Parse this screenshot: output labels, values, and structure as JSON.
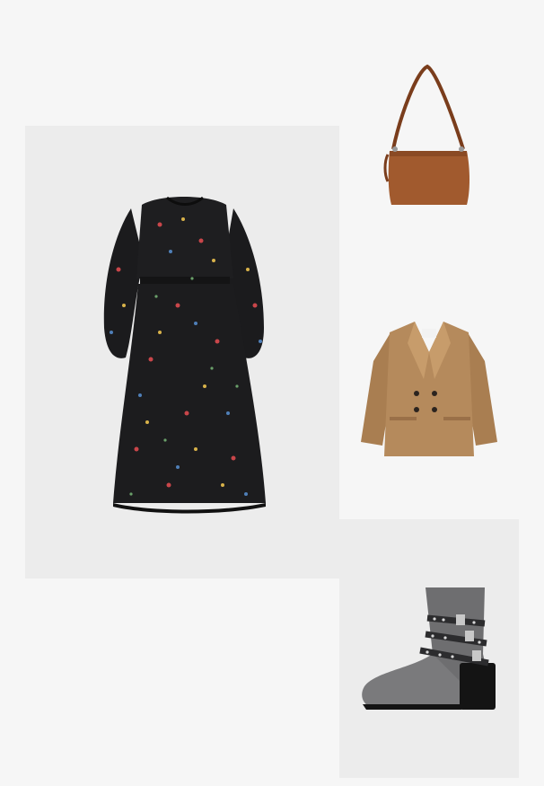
{
  "outfit": {
    "items": [
      {
        "id": "dress",
        "name": "floral-midi-dress",
        "color": "#1b1b1d",
        "panel_color": "#ececec"
      },
      {
        "id": "bag",
        "name": "leather-shoulder-bag",
        "color": "#a15a2e"
      },
      {
        "id": "blazer",
        "name": "double-breasted-blazer",
        "color": "#b58a5c"
      },
      {
        "id": "boots",
        "name": "metallic-buckle-boots",
        "color": "#6e6e70",
        "panel_color": "#ececec"
      }
    ]
  }
}
